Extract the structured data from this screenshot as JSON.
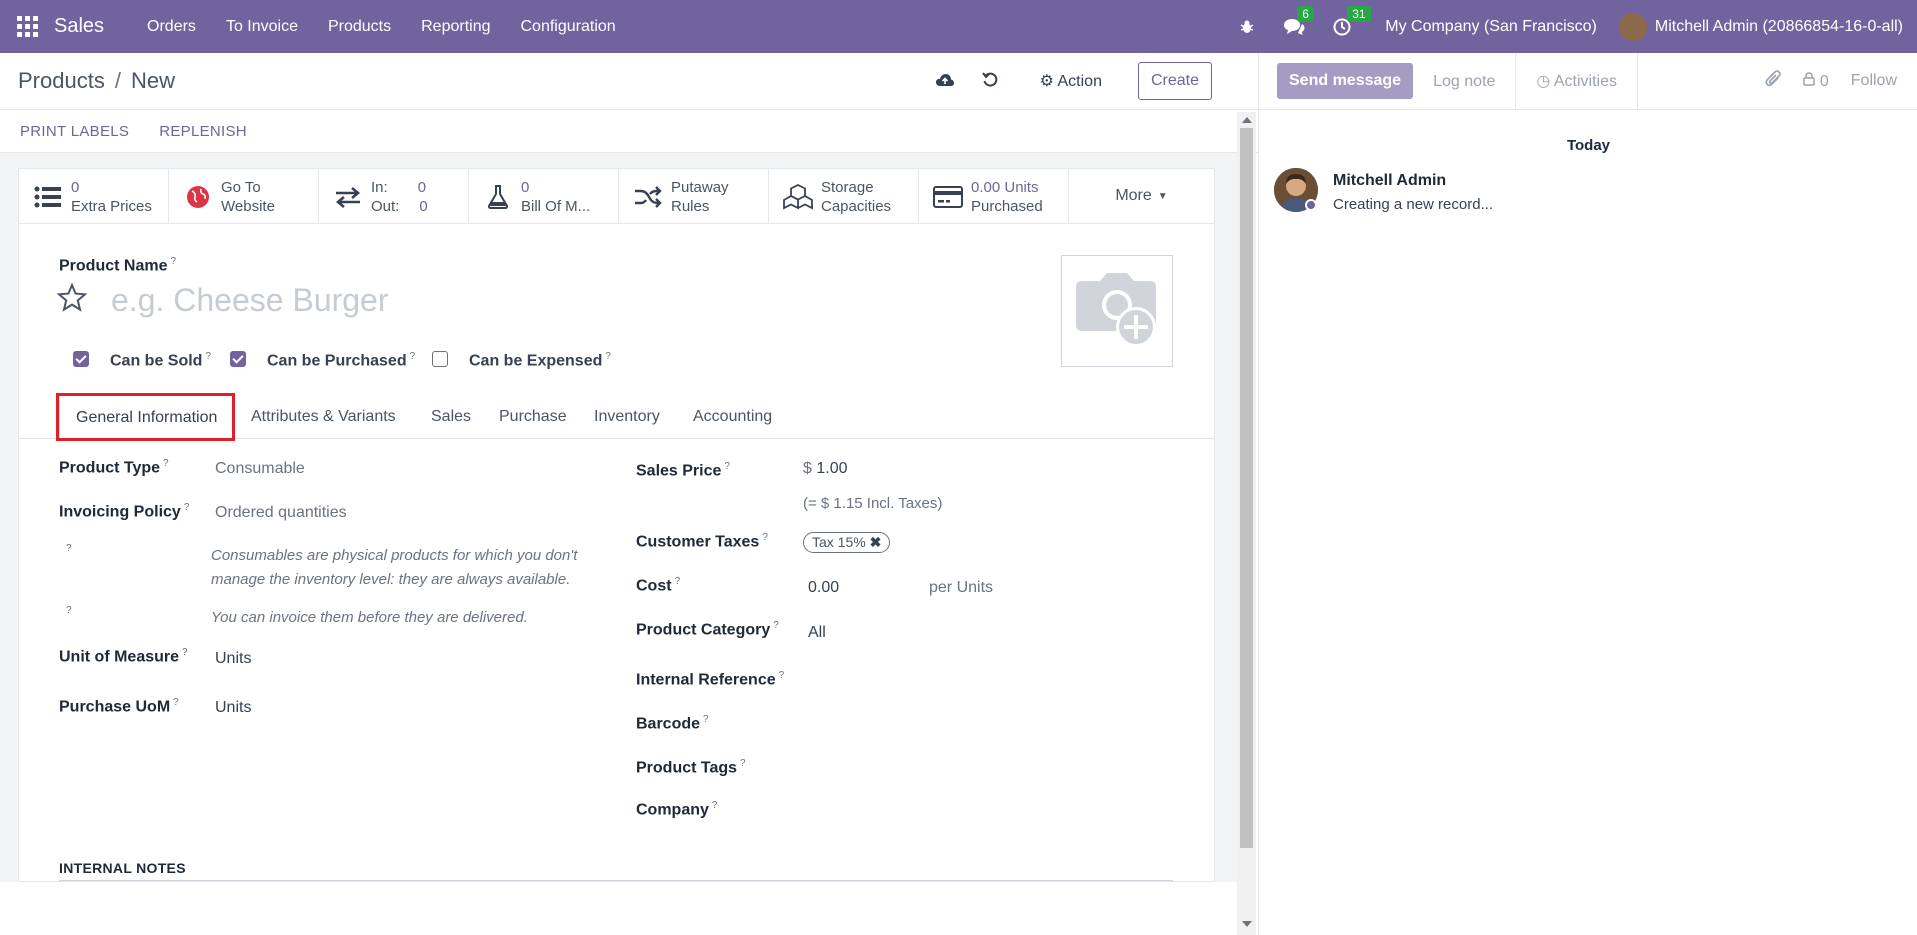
{
  "navbar": {
    "app_name": "Sales",
    "menu": [
      "Orders",
      "To Invoice",
      "Products",
      "Reporting",
      "Configuration"
    ],
    "messages_count": "6",
    "activities_count": "31",
    "company": "My Company (San Francisco)",
    "user": "Mitchell Admin (20866854-16-0-all)"
  },
  "breadcrumb": {
    "parent": "Products",
    "current": "New"
  },
  "control": {
    "action_label": "Action",
    "create_label": "Create"
  },
  "statusbar": {
    "print_labels": "PRINT LABELS",
    "replenish": "REPLENISH"
  },
  "smart_buttons": {
    "extra_prices": {
      "value": "0",
      "label": "Extra Prices"
    },
    "website": {
      "line1": "Go To",
      "line2": "Website"
    },
    "in_out": {
      "in_label": "In:",
      "in_value": "0",
      "out_label": "Out:",
      "out_value": "0"
    },
    "bom": {
      "value": "0",
      "label": "Bill Of M..."
    },
    "putaway": {
      "line1": "Putaway",
      "line2": "Rules"
    },
    "storage": {
      "line1": "Storage",
      "line2": "Capacities"
    },
    "purchased": {
      "value": "0.00 Units",
      "label": "Purchased"
    },
    "more": "More"
  },
  "product": {
    "name_label": "Product Name",
    "name_placeholder": "e.g. Cheese Burger",
    "can_be_sold": "Can be Sold",
    "can_be_purchased": "Can be Purchased",
    "can_be_expensed": "Can be Expensed",
    "can_be_sold_checked": true,
    "can_be_purchased_checked": true,
    "can_be_expensed_checked": false
  },
  "tabs": [
    "General Information",
    "Attributes & Variants",
    "Sales",
    "Purchase",
    "Inventory",
    "Accounting"
  ],
  "general": {
    "product_type_label": "Product Type",
    "product_type": "Consumable",
    "invoicing_policy_label": "Invoicing Policy",
    "invoicing_policy": "Ordered quantities",
    "help_consumable_1": "Consumables are physical products for which you don't",
    "help_consumable_2": "manage the inventory level: they are always available.",
    "help_invoice": "You can invoice them before they are delivered.",
    "uom_label": "Unit of Measure",
    "uom": "Units",
    "purchase_uom_label": "Purchase UoM",
    "purchase_uom": "Units",
    "sales_price_label": "Sales Price",
    "currency": "$",
    "sales_price": "1.00",
    "incl_taxes": "(= $ 1.15 Incl. Taxes)",
    "customer_taxes_label": "Customer Taxes",
    "tax_tag": "Tax 15%",
    "cost_label": "Cost",
    "cost": "0.00",
    "cost_unit": "per Units",
    "product_category_label": "Product Category",
    "product_category": "All",
    "internal_reference_label": "Internal Reference",
    "barcode_label": "Barcode",
    "product_tags_label": "Product Tags",
    "company_label": "Company",
    "internal_notes": "INTERNAL NOTES"
  },
  "chatter": {
    "send_message": "Send message",
    "log_note": "Log note",
    "activities": "Activities",
    "followers_count": "0",
    "follow": "Follow",
    "date_separator": "Today",
    "author": "Mitchell Admin",
    "message": "Creating a new record..."
  },
  "colors": {
    "brand": "#71639e",
    "highlight": "#e02027",
    "badge": "#28a745"
  }
}
